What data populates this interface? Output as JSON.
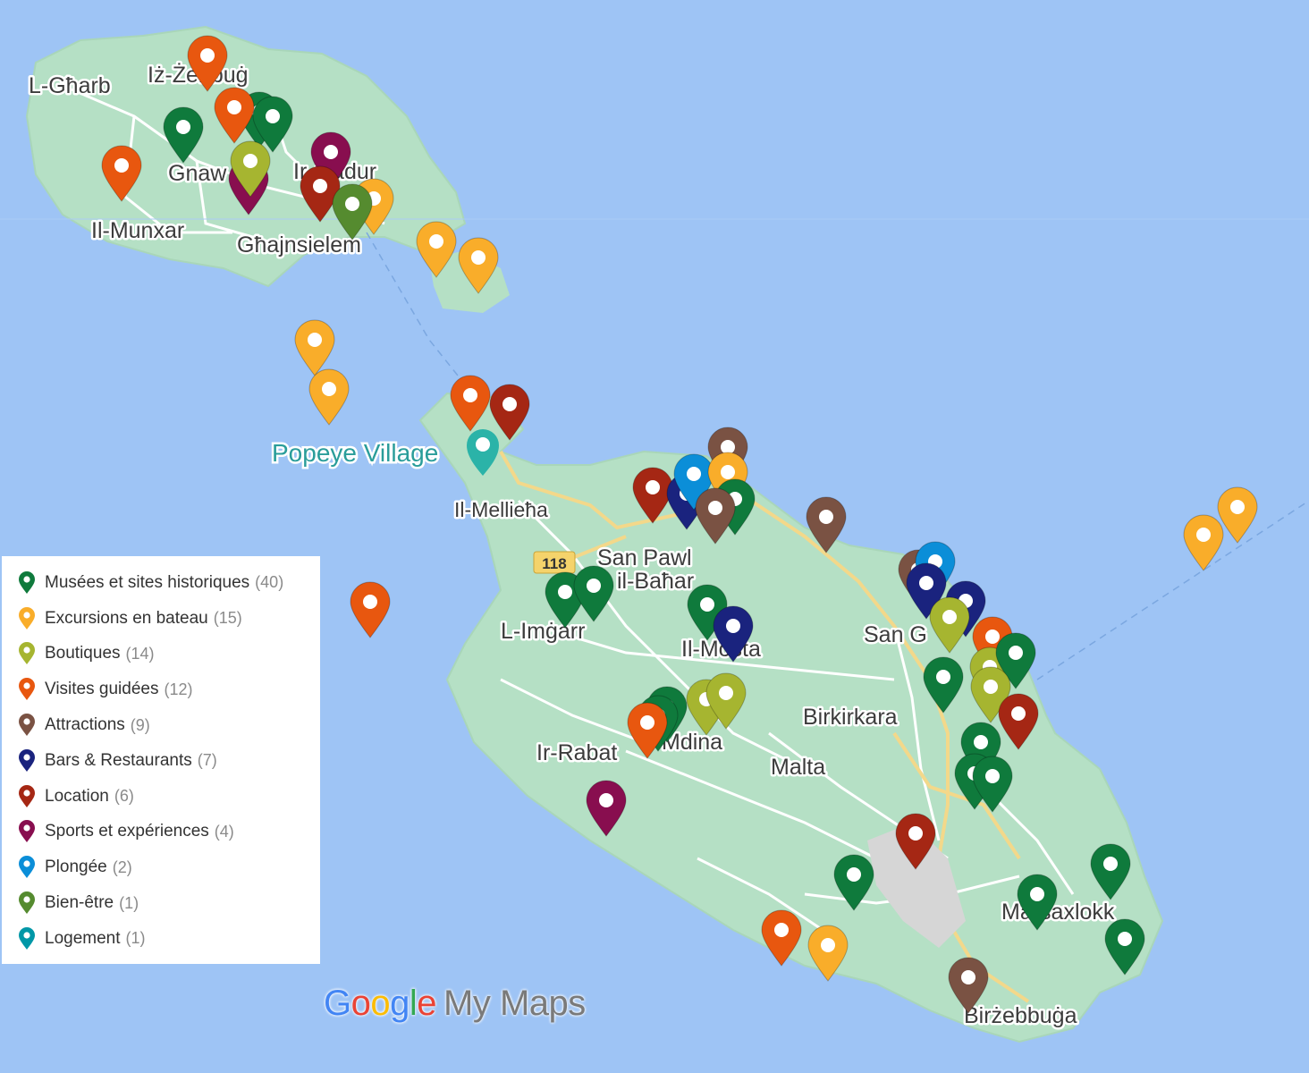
{
  "map": {
    "place_labels": {
      "gharb": "L-Għarb",
      "zebbug": "Iż-Żebbuġ",
      "gnaw": "Gnaw",
      "munxar": "Il-Munxar",
      "qala": "Ir-Qadur",
      "ghajnsielem": "Għajnsielem",
      "mellieha": "Il-Mellieħa",
      "sanpawl1": "San Pawl",
      "sanpawl2": "il-Baħar",
      "imgarr": "L-Imġarr",
      "mosta": "Il-Mosta",
      "sang": "San G",
      "birkirkara": "Birkirkara",
      "rabat": "Ir-Rabat",
      "mdina": "Mdina",
      "malta": "Malta",
      "marsaxlokk": "Marsaxlokk",
      "birzebbuga": "Birżebbuġa"
    },
    "poi_label": "Popeye Village",
    "route_number": "118"
  },
  "categories": [
    {
      "label": "Musées et sites historiques",
      "count": "(40)",
      "color": "#0f7a3c"
    },
    {
      "label": "Excursions en bateau",
      "count": "(15)",
      "color": "#f9ad2a"
    },
    {
      "label": "Boutiques",
      "count": "(14)",
      "color": "#a6b530"
    },
    {
      "label": "Visites guidées",
      "count": "(12)",
      "color": "#e8570f"
    },
    {
      "label": "Attractions",
      "count": "(9)",
      "color": "#7a5243"
    },
    {
      "label": "Bars & Restaurants",
      "count": "(7)",
      "color": "#1a237e"
    },
    {
      "label": "Location",
      "count": "(6)",
      "color": "#a52714"
    },
    {
      "label": "Sports et expériences",
      "count": "(4)",
      "color": "#880e4f"
    },
    {
      "label": "Plongée",
      "count": "(2)",
      "color": "#0b8ed8"
    },
    {
      "label": "Bien-être",
      "count": "(1)",
      "color": "#558b2f"
    },
    {
      "label": "Logement",
      "count": "(1)",
      "color": "#0097a7"
    }
  ],
  "markers": [
    {
      "cat": 3
    },
    {
      "cat": 3
    },
    {
      "cat": 0
    },
    {
      "cat": 0
    },
    {
      "cat": 0
    },
    {
      "cat": 3
    },
    {
      "cat": 7
    },
    {
      "cat": 7
    },
    {
      "cat": 2
    },
    {
      "cat": 6
    },
    {
      "cat": 1
    },
    {
      "cat": 9
    },
    {
      "cat": 1
    },
    {
      "cat": 1
    },
    {
      "cat": 1
    },
    {
      "cat": 1
    },
    {
      "cat": 3
    },
    {
      "cat": 6
    },
    {
      "cat": 4
    },
    {
      "cat": 6
    },
    {
      "cat": 5
    },
    {
      "cat": 8
    },
    {
      "cat": 1
    },
    {
      "cat": 0
    },
    {
      "cat": 4
    },
    {
      "cat": 4
    },
    {
      "cat": 1
    },
    {
      "cat": 1
    },
    {
      "cat": 0
    },
    {
      "cat": 0
    },
    {
      "cat": 0
    },
    {
      "cat": 5
    },
    {
      "cat": 3
    },
    {
      "cat": 0
    },
    {
      "cat": 0
    },
    {
      "cat": 3
    },
    {
      "cat": 2
    },
    {
      "cat": 2
    },
    {
      "cat": 7
    },
    {
      "cat": 4
    },
    {
      "cat": 8
    },
    {
      "cat": 5
    },
    {
      "cat": 5
    },
    {
      "cat": 2
    },
    {
      "cat": 3
    },
    {
      "cat": 2
    },
    {
      "cat": 0
    },
    {
      "cat": 0
    },
    {
      "cat": 2
    },
    {
      "cat": 6
    },
    {
      "cat": 0
    },
    {
      "cat": 0
    },
    {
      "cat": 0
    },
    {
      "cat": 6
    },
    {
      "cat": 0
    },
    {
      "cat": 0
    },
    {
      "cat": 0
    },
    {
      "cat": 0
    },
    {
      "cat": 3
    },
    {
      "cat": 1
    },
    {
      "cat": 4
    }
  ],
  "branding": {
    "g1": "G",
    "g2": "o",
    "g3": "o",
    "g4": "g",
    "g5": "l",
    "g6": "e",
    "rest": "My Maps"
  }
}
